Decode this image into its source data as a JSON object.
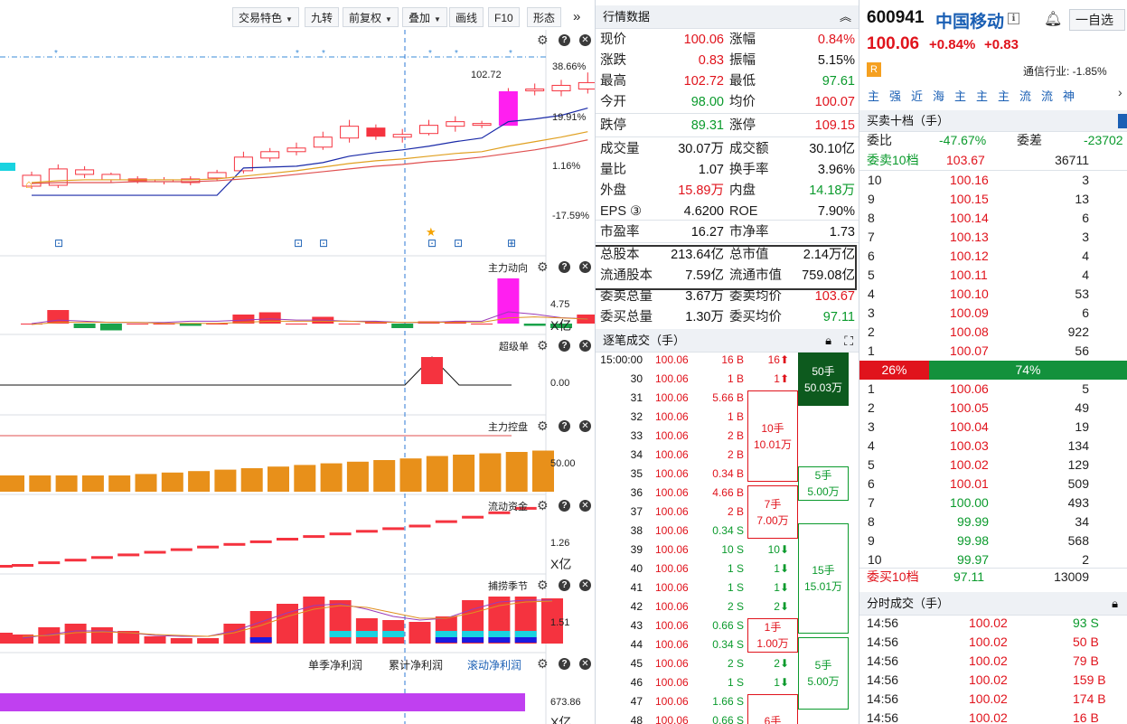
{
  "toolbar": {
    "trading_features": "交易特色",
    "jiuzhuan": "九转",
    "adjust": "前复权",
    "overlay": "叠加",
    "draw_line": "画线",
    "f10": "F10",
    "pattern": "形态",
    "expand": "»"
  },
  "kline": {
    "max_label": "102.72",
    "y_ticks": [
      "38.66%",
      "19.91%",
      "1.16%",
      "-17.59%"
    ],
    "candles": [
      {
        "o": 90.2,
        "c": 91.4,
        "h": 91.8,
        "l": 89.9
      },
      {
        "o": 90.3,
        "c": 92.1,
        "h": 92.6,
        "l": 90.0
      },
      {
        "o": 92.0,
        "c": 91.5,
        "h": 92.4,
        "l": 91.1
      },
      {
        "o": 91.5,
        "c": 90.9,
        "h": 91.7,
        "l": 90.6
      },
      {
        "o": 90.8,
        "c": 91.0,
        "h": 91.3,
        "l": 90.5
      },
      {
        "o": 90.9,
        "c": 90.7,
        "h": 91.2,
        "l": 90.4
      },
      {
        "o": 90.6,
        "c": 91.0,
        "h": 91.3,
        "l": 90.3
      },
      {
        "o": 91.1,
        "c": 91.7,
        "h": 92.0,
        "l": 90.8
      },
      {
        "o": 91.9,
        "c": 93.4,
        "h": 94.0,
        "l": 91.6
      },
      {
        "o": 93.3,
        "c": 94.0,
        "h": 94.4,
        "l": 92.9
      },
      {
        "o": 94.0,
        "c": 94.4,
        "h": 95.0,
        "l": 93.6
      },
      {
        "o": 94.5,
        "c": 95.6,
        "h": 96.2,
        "l": 94.2
      },
      {
        "o": 95.5,
        "c": 96.8,
        "h": 97.5,
        "l": 95.0
      },
      {
        "o": 96.6,
        "c": 95.7,
        "h": 97.0,
        "l": 95.3
      },
      {
        "o": 95.6,
        "c": 95.9,
        "h": 96.5,
        "l": 95.0
      },
      {
        "o": 96.0,
        "c": 96.9,
        "h": 97.5,
        "l": 95.8
      },
      {
        "o": 96.8,
        "c": 97.3,
        "h": 97.9,
        "l": 96.2
      },
      {
        "o": 97.1,
        "c": 97.0,
        "h": 97.4,
        "l": 96.6
      },
      {
        "o": 96.9,
        "c": 100.6,
        "h": 101.0,
        "l": 96.9
      },
      {
        "o": 100.9,
        "c": 100.7,
        "h": 101.5,
        "l": 100.2
      },
      {
        "o": 100.7,
        "c": 101.3,
        "h": 101.9,
        "l": 100.1
      },
      {
        "o": 100.9,
        "c": 101.6,
        "h": 102.72,
        "l": 100.4
      }
    ]
  },
  "indicators": {
    "main_force": {
      "name": "主力动向",
      "value": "4.75",
      "unit": "X亿"
    },
    "super_order": {
      "name": "超级单",
      "value": "0.00"
    },
    "control": {
      "name": "主力控盘",
      "value": "50.00"
    },
    "liquidity": {
      "name": "流动资金",
      "value": "1.26",
      "unit": "X亿"
    },
    "season": {
      "name": "捕捞季节",
      "value": "1.51"
    },
    "profit": {
      "tab1": "单季净利润",
      "tab2": "累计净利润",
      "tab3": "滚动净利润",
      "value": "673.86",
      "unit": "X亿"
    }
  },
  "quote": {
    "title": "行情数据",
    "rows": [
      [
        [
          "现价",
          "100.06",
          "red"
        ],
        [
          "涨幅",
          "0.84%",
          "red"
        ]
      ],
      [
        [
          "涨跌",
          "0.83",
          "red"
        ],
        [
          "振幅",
          "5.15%",
          "blk"
        ]
      ],
      [
        [
          "最高",
          "102.72",
          "red"
        ],
        [
          "最低",
          "97.61",
          "green"
        ]
      ],
      [
        [
          "今开",
          "98.00",
          "green"
        ],
        [
          "均价",
          "100.07",
          "red"
        ]
      ],
      [
        [
          "跌停",
          "89.31",
          "green"
        ],
        [
          "涨停",
          "109.15",
          "red"
        ]
      ],
      [
        [
          "成交量",
          "30.07万",
          "blk"
        ],
        [
          "成交额",
          "30.10亿",
          "blk"
        ]
      ],
      [
        [
          "量比",
          "1.07",
          "blk"
        ],
        [
          "换手率",
          "3.96%",
          "blk"
        ]
      ],
      [
        [
          "外盘",
          "15.89万",
          "red"
        ],
        [
          "内盘",
          "14.18万",
          "green"
        ]
      ],
      [
        [
          "EPS ③",
          "4.6200",
          "blk"
        ],
        [
          "ROE",
          "7.90%",
          "blk"
        ]
      ],
      [
        [
          "市盈率",
          "16.27",
          "blk"
        ],
        [
          "市净率",
          "1.73",
          "blk"
        ]
      ],
      [
        [
          "总股本",
          "213.64亿",
          "blk"
        ],
        [
          "总市值",
          "2.14万亿",
          "blk"
        ]
      ],
      [
        [
          "流通股本",
          "7.59亿",
          "blk"
        ],
        [
          "流通市值",
          "759.08亿",
          "blk"
        ]
      ],
      [
        [
          "委卖总量",
          "3.67万",
          "blk"
        ],
        [
          "委卖均价",
          "103.67",
          "red"
        ]
      ],
      [
        [
          "委买总量",
          "1.30万",
          "blk"
        ],
        [
          "委买均价",
          "97.11",
          "green"
        ]
      ]
    ]
  },
  "ticks": {
    "title": "逐笔成交（手）",
    "rows": [
      [
        "15:00:00",
        "100.06",
        "16 B",
        "16⬆",
        "red"
      ],
      [
        "30",
        "100.06",
        "1 B",
        "1⬆",
        "red"
      ],
      [
        "31",
        "100.06",
        "5.66 B",
        "",
        "red"
      ],
      [
        "32",
        "100.06",
        "1 B",
        "1⬆",
        "red"
      ],
      [
        "33",
        "100.06",
        "2 B",
        "1⬆",
        "red"
      ],
      [
        "34",
        "100.06",
        "2 B",
        "2⬆",
        "red"
      ],
      [
        "35",
        "100.06",
        "0.34 B",
        "",
        "red"
      ],
      [
        "36",
        "100.06",
        "4.66 B",
        "",
        "red"
      ],
      [
        "37",
        "100.06",
        "2 B",
        "2⬆",
        "red"
      ],
      [
        "38",
        "100.06",
        "0.34 S",
        "",
        "green"
      ],
      [
        "39",
        "100.06",
        "10 S",
        "10⬇",
        "green"
      ],
      [
        "40",
        "100.06",
        "1 S",
        "1⬇",
        "green"
      ],
      [
        "41",
        "100.06",
        "1 S",
        "1⬇",
        "green"
      ],
      [
        "42",
        "100.06",
        "2 S",
        "2⬇",
        "green"
      ],
      [
        "43",
        "100.06",
        "0.66 S",
        "",
        "green"
      ],
      [
        "44",
        "100.06",
        "0.34 S",
        "",
        "green"
      ],
      [
        "45",
        "100.06",
        "2 S",
        "2⬇",
        "green"
      ],
      [
        "46",
        "100.06",
        "1 S",
        "1⬇",
        "green"
      ],
      [
        "47",
        "100.06",
        "1.66 S",
        "",
        "green"
      ],
      [
        "48",
        "100.06",
        "0.66 S",
        "",
        "green"
      ]
    ],
    "blocks": [
      {
        "line1": "50手",
        "line2": "50.03万",
        "col": "r",
        "kind": "dark",
        "start": 0,
        "end": 3
      },
      {
        "line1": "10手",
        "line2": "10.01万",
        "col": "l",
        "kind": "red",
        "start": 2,
        "end": 7
      },
      {
        "line1": "5手",
        "line2": "5.00万",
        "col": "r",
        "kind": "green",
        "start": 6,
        "end": 8
      },
      {
        "line1": "7手",
        "line2": "7.00万",
        "col": "l",
        "kind": "red",
        "start": 7,
        "end": 10
      },
      {
        "line1": "15手",
        "line2": "15.01万",
        "col": "r",
        "kind": "green",
        "start": 9,
        "end": 15
      },
      {
        "line1": "1手",
        "line2": "1.00万",
        "col": "l",
        "kind": "red",
        "start": 14,
        "end": 16
      },
      {
        "line1": "5手",
        "line2": "5.00万",
        "col": "r",
        "kind": "green",
        "start": 15,
        "end": 19
      },
      {
        "line1": "6手",
        "line2": "",
        "col": "l",
        "kind": "red",
        "start": 18,
        "end": 21
      }
    ]
  },
  "stock": {
    "code": "600941",
    "name": "中国移动",
    "info": "ℹ",
    "price": "100.06",
    "change_pct": "+0.84%",
    "change": "+0.83",
    "r_badge": "R",
    "industry": "通信行业: -1.85%",
    "watch": "一自选",
    "tags": [
      "主",
      "强",
      "近",
      "海",
      "主",
      "主",
      "主",
      "流",
      "流",
      "神"
    ]
  },
  "orderbook": {
    "title": "买卖十档（手）",
    "ratio_label": "委比",
    "ratio_value": "-47.67%",
    "diff_label": "委差",
    "diff_value": "-23702",
    "sell_label": "委卖10档",
    "sell_price": "103.67",
    "sell_qty": "36711",
    "asks": [
      [
        "10",
        "100.16",
        "3"
      ],
      [
        "9",
        "100.15",
        "13"
      ],
      [
        "8",
        "100.14",
        "6"
      ],
      [
        "7",
        "100.13",
        "3"
      ],
      [
        "6",
        "100.12",
        "4"
      ],
      [
        "5",
        "100.11",
        "4"
      ],
      [
        "4",
        "100.10",
        "53"
      ],
      [
        "3",
        "100.09",
        "6"
      ],
      [
        "2",
        "100.08",
        "922"
      ],
      [
        "1",
        "100.07",
        "56"
      ]
    ],
    "bar_sell": "26%",
    "bar_buy": "74%",
    "bids": [
      [
        "1",
        "100.06",
        "5"
      ],
      [
        "2",
        "100.05",
        "49"
      ],
      [
        "3",
        "100.04",
        "19"
      ],
      [
        "4",
        "100.03",
        "134"
      ],
      [
        "5",
        "100.02",
        "129"
      ],
      [
        "6",
        "100.01",
        "509"
      ],
      [
        "7",
        "100.00",
        "493"
      ],
      [
        "8",
        "99.99",
        "34"
      ],
      [
        "9",
        "99.98",
        "568"
      ],
      [
        "10",
        "99.97",
        "2"
      ]
    ],
    "buy_label": "委买10档",
    "buy_price": "97.11",
    "buy_qty": "13009"
  },
  "time_trades": {
    "title": "分时成交（手）",
    "rows": [
      [
        "14:56",
        "100.02",
        "93 S"
      ],
      [
        "14:56",
        "100.02",
        "50 B"
      ],
      [
        "14:56",
        "100.02",
        "79 B"
      ],
      [
        "14:56",
        "100.02",
        "159 B"
      ],
      [
        "14:56",
        "100.02",
        "174 B"
      ],
      [
        "14:56",
        "100.02",
        "16 B"
      ]
    ]
  },
  "colors": {
    "up": "#f5333f",
    "down": "#1aa34a",
    "accent": "#1a5fb4",
    "magenta": "#ff1ff0"
  }
}
